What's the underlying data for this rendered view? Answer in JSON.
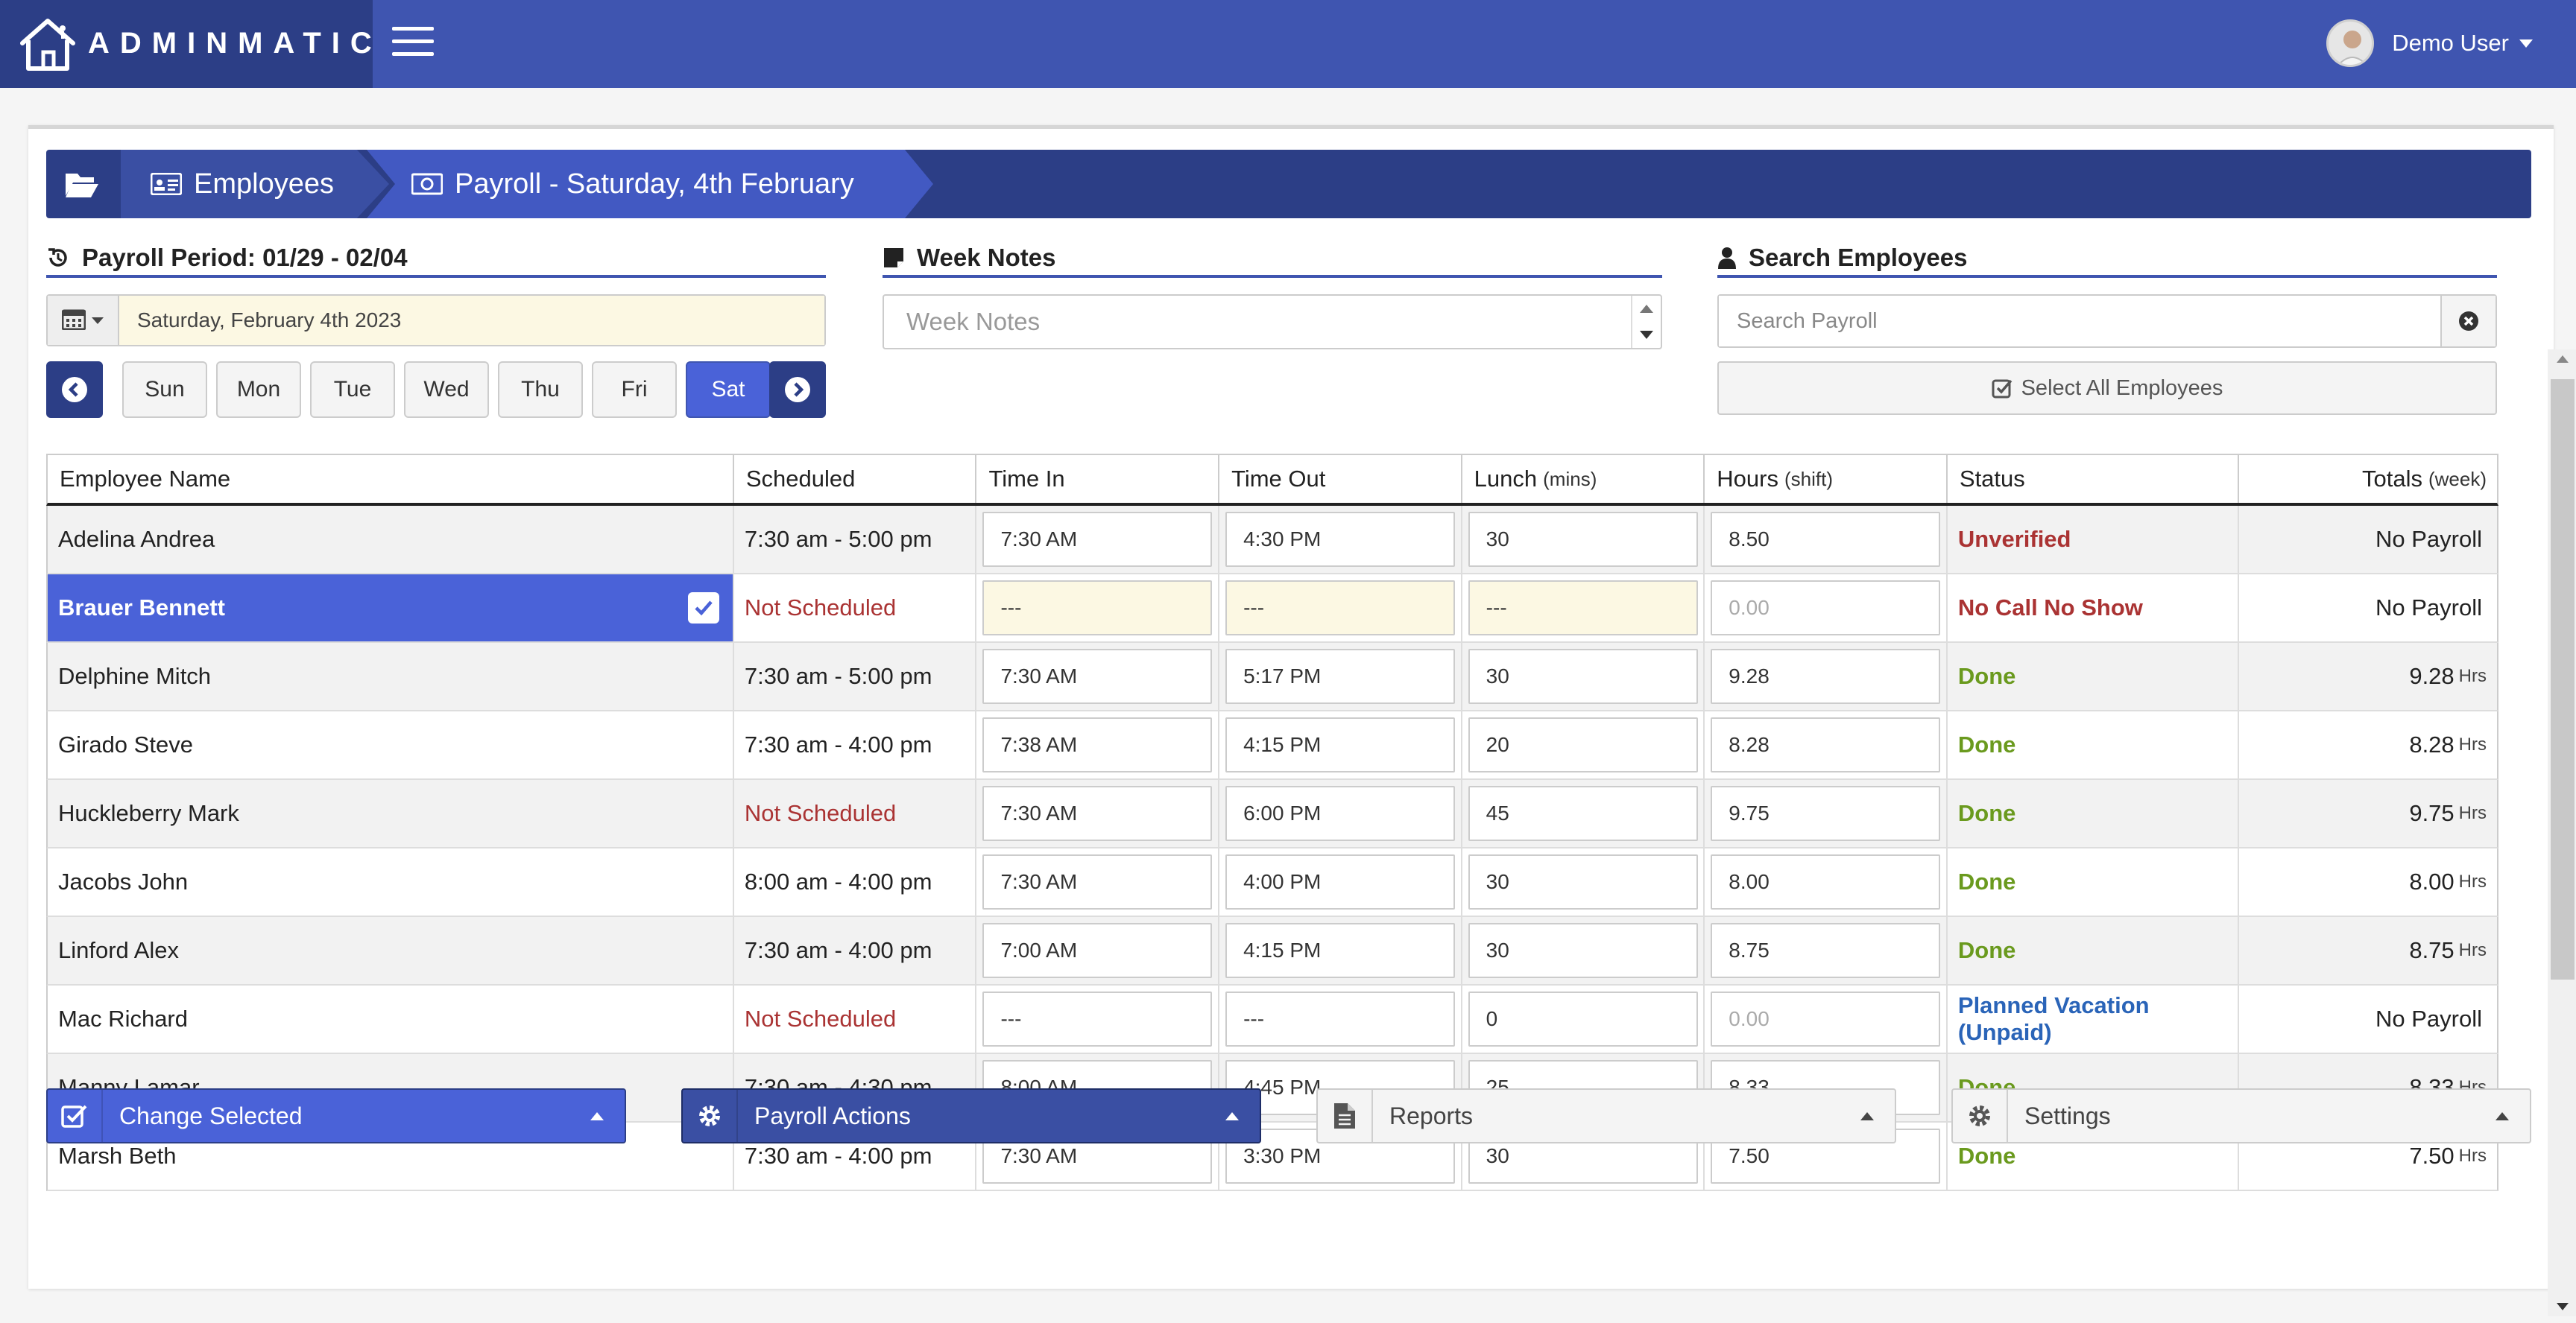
{
  "app": {
    "brand": "ADMINMATIC",
    "user_name": "Demo User"
  },
  "breadcrumb": {
    "item1": "Employees",
    "item2": "Payroll - Saturday, 4th February"
  },
  "payroll_period": {
    "heading": "Payroll Period: 01/29 - 02/04",
    "date_value": "Saturday, February 4th 2023"
  },
  "days": {
    "sun": "Sun",
    "mon": "Mon",
    "tue": "Tue",
    "wed": "Wed",
    "thu": "Thu",
    "fri": "Fri",
    "sat": "Sat",
    "active": "Sat"
  },
  "week_notes": {
    "heading": "Week Notes",
    "placeholder": "Week Notes"
  },
  "search": {
    "heading": "Search Employees",
    "placeholder": "Search Payroll",
    "select_all": "Select All Employees"
  },
  "table": {
    "headers": {
      "name": "Employee Name",
      "scheduled": "Scheduled",
      "time_in": "Time In",
      "time_out": "Time Out",
      "lunch": "Lunch",
      "lunch_unit": "(mins)",
      "hours": "Hours",
      "hours_unit": "(shift)",
      "status": "Status",
      "totals": "Totals",
      "totals_unit": "(week)"
    },
    "rows": [
      {
        "name": "Adelina Andrea",
        "scheduled": "7:30 am - 5:00 pm",
        "time_in": "7:30 AM",
        "time_out": "4:30 PM",
        "lunch": "30",
        "hours": "8.50",
        "status": "Unverified",
        "total": "No Payroll",
        "total_unit": ""
      },
      {
        "name": "Brauer Bennett",
        "scheduled": "Not Scheduled",
        "time_in": "---",
        "time_out": "---",
        "lunch": "---",
        "hours": "0.00",
        "status": "No Call No Show",
        "total": "No Payroll",
        "total_unit": ""
      },
      {
        "name": "Delphine Mitch",
        "scheduled": "7:30 am - 5:00 pm",
        "time_in": "7:30 AM",
        "time_out": "5:17 PM",
        "lunch": "30",
        "hours": "9.28",
        "status": "Done",
        "total": "9.28",
        "total_unit": "Hrs"
      },
      {
        "name": "Girado Steve",
        "scheduled": "7:30 am - 4:00 pm",
        "time_in": "7:38 AM",
        "time_out": "4:15 PM",
        "lunch": "20",
        "hours": "8.28",
        "status": "Done",
        "total": "8.28",
        "total_unit": "Hrs"
      },
      {
        "name": "Huckleberry Mark",
        "scheduled": "Not Scheduled",
        "time_in": "7:30 AM",
        "time_out": "6:00 PM",
        "lunch": "45",
        "hours": "9.75",
        "status": "Done",
        "total": "9.75",
        "total_unit": "Hrs"
      },
      {
        "name": "Jacobs John",
        "scheduled": "8:00 am - 4:00 pm",
        "time_in": "7:30 AM",
        "time_out": "4:00 PM",
        "lunch": "30",
        "hours": "8.00",
        "status": "Done",
        "total": "8.00",
        "total_unit": "Hrs"
      },
      {
        "name": "Linford Alex",
        "scheduled": "7:30 am - 4:00 pm",
        "time_in": "7:00 AM",
        "time_out": "4:15 PM",
        "lunch": "30",
        "hours": "8.75",
        "status": "Done",
        "total": "8.75",
        "total_unit": "Hrs"
      },
      {
        "name": "Mac Richard",
        "scheduled": "Not Scheduled",
        "time_in": "---",
        "time_out": "---",
        "lunch": "0",
        "hours": "0.00",
        "status": "Planned Vacation (Unpaid)",
        "total": "No Payroll",
        "total_unit": ""
      },
      {
        "name": "Manny Lamar",
        "scheduled": "7:30 am - 4:30 pm",
        "time_in": "8:00 AM",
        "time_out": "4:45 PM",
        "lunch": "25",
        "hours": "8.33",
        "status": "Done",
        "total": "8.33",
        "total_unit": "Hrs"
      },
      {
        "name": "Marsh Beth",
        "scheduled": "7:30 am - 4:00 pm",
        "time_in": "7:30 AM",
        "time_out": "3:30 PM",
        "lunch": "30",
        "hours": "7.50",
        "status": "Done",
        "total": "7.50",
        "total_unit": "Hrs"
      }
    ]
  },
  "footer": {
    "change_selected": "Change Selected",
    "payroll_actions": "Payroll Actions",
    "reports": "Reports",
    "settings": "Settings"
  },
  "colors": {
    "navbar": "#3f55b0",
    "navy": "#2c3e86",
    "accent": "#4a62d8",
    "done": "#6a9a1e",
    "alert": "#a33333",
    "info": "#2a64b8",
    "highlight": "#fcf8e3"
  },
  "icons": [
    "house-logo-icon",
    "hamburger-icon",
    "avatar-icon",
    "folder-open-icon",
    "id-card-icon",
    "money-icon",
    "history-icon",
    "sticky-note-icon",
    "user-icon",
    "calendar-icon",
    "chevron-left-icon",
    "chevron-right-icon",
    "close-circle-icon",
    "check-square-icon",
    "gear-icon",
    "file-text-icon"
  ]
}
